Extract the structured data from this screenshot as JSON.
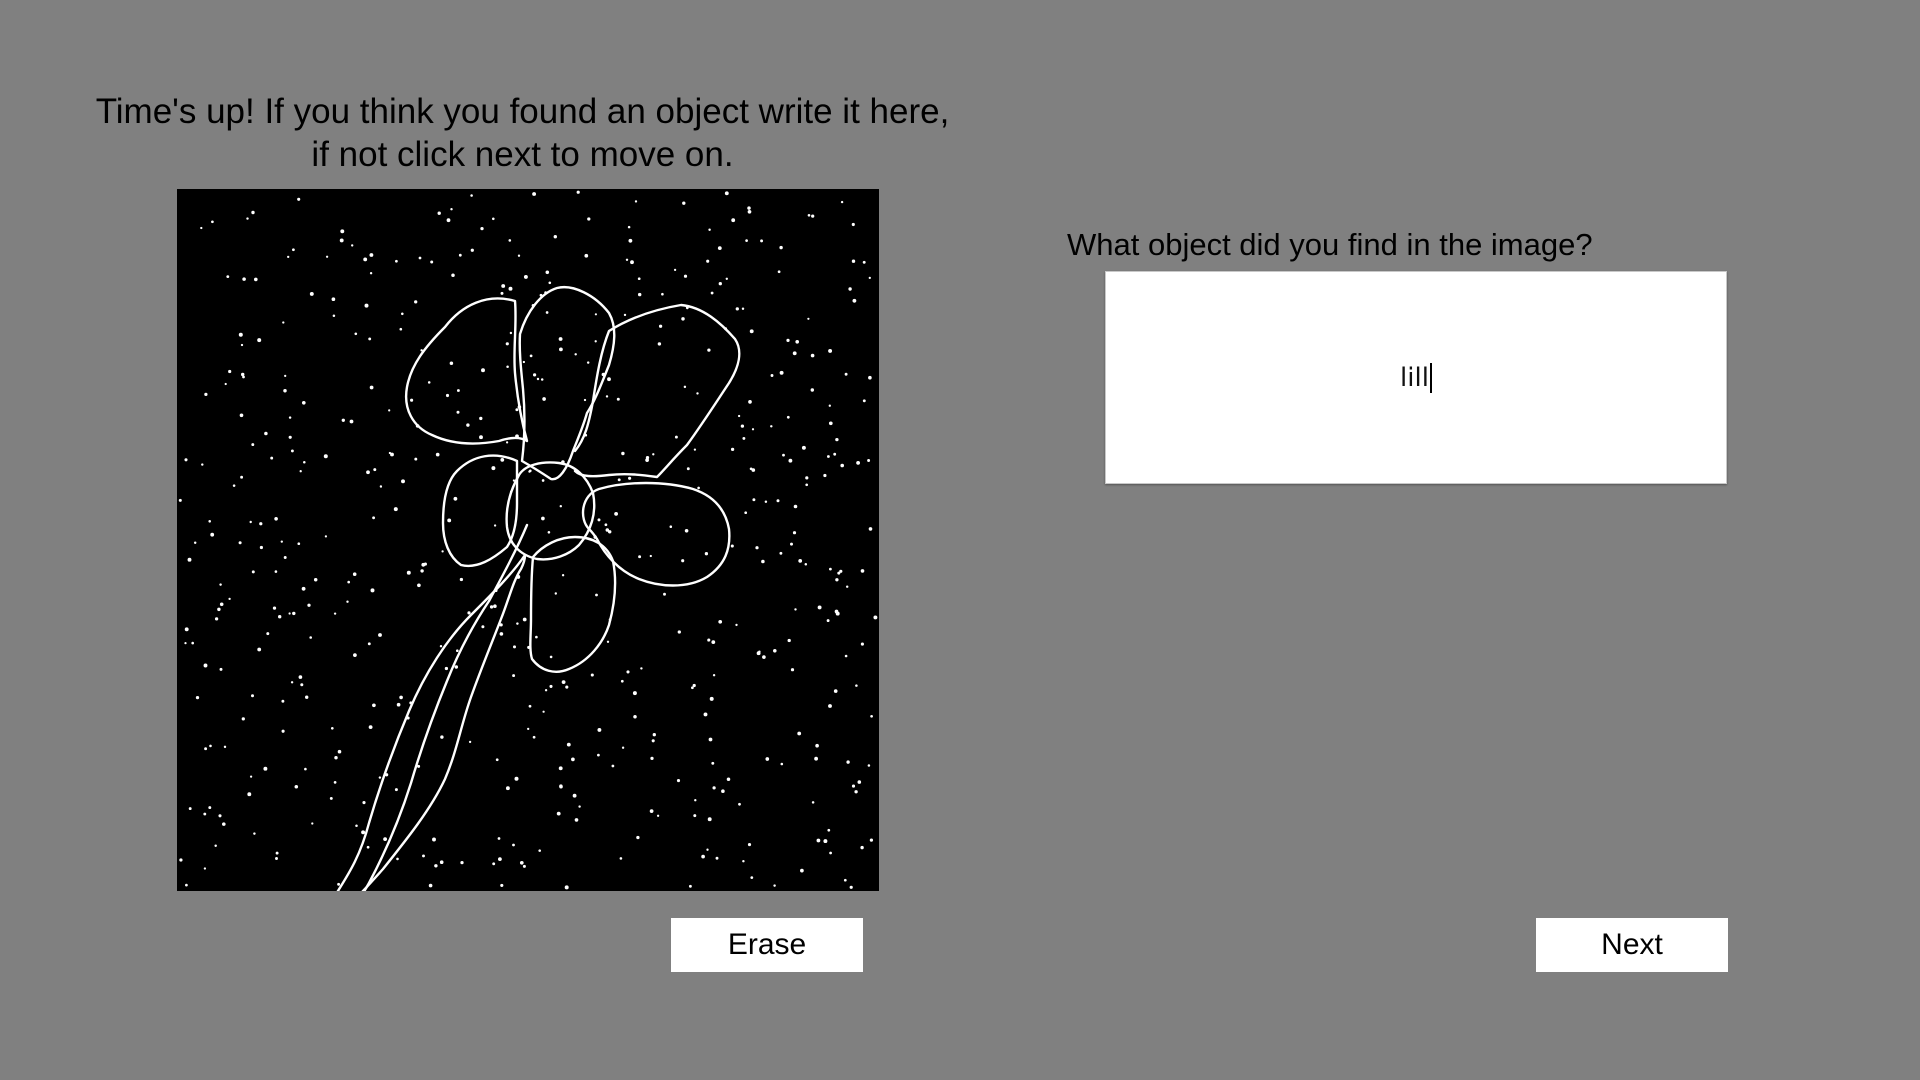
{
  "instruction": {
    "line1": "Time's up! If you think you found an object write it here,",
    "line2": "if not click next to move on."
  },
  "question": {
    "label": "What object did you find in the image?"
  },
  "answer": {
    "value": "lill"
  },
  "buttons": {
    "erase_label": "Erase",
    "next_label": "Next"
  },
  "canvas": {
    "background_color": "#000000",
    "dot_color": "#ffffff",
    "stroke_color": "#ffffff"
  }
}
